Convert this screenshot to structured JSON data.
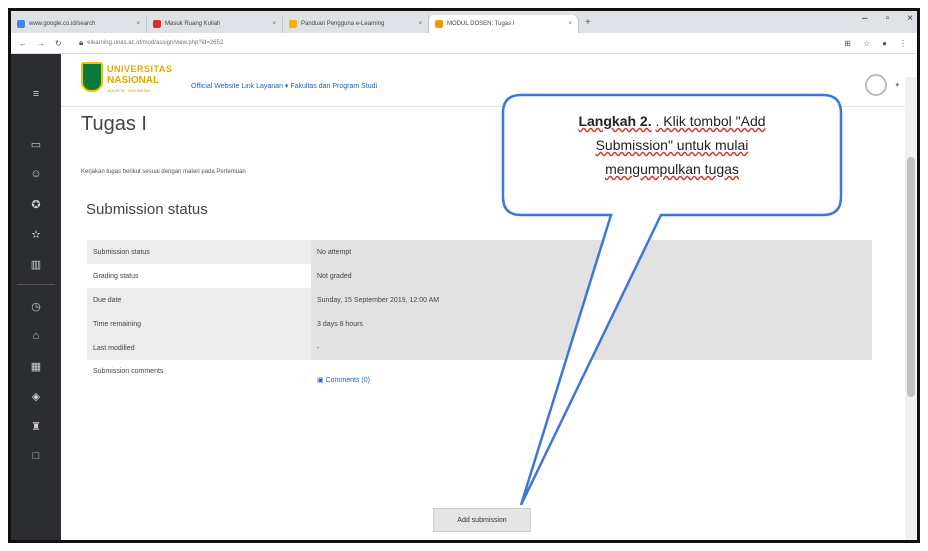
{
  "browser": {
    "tabs": [
      {
        "label": "www.google.co.id/search",
        "color": "#4285f4"
      },
      {
        "label": "Masuk Ruang Kuliah",
        "color": "#d93025"
      },
      {
        "label": "Panduan Pengguna e-Learning",
        "color": "#f4b400"
      },
      {
        "label": "MODUL DOSEN: Tugas I",
        "color": "#f29900"
      }
    ],
    "url": "elearning.unas.ac.id/mod/assign/view.php?id=2652"
  },
  "site": {
    "logo_line1": "UNIVERSITAS",
    "logo_line2": "NASIONAL",
    "logo_line3": "JAKARTA · INDONESIA",
    "menu_text": "Official Website   Link Layanan ▾   Fakultas dan Program Studi"
  },
  "page": {
    "title": "Tugas I",
    "description": "Kerjakan tugas berikut sesuai dengan materi pada Pertemuan",
    "section_title": "Submission status"
  },
  "status_table": [
    {
      "label": "Submission status",
      "value": "No attempt"
    },
    {
      "label": "Grading status",
      "value": "Not graded"
    },
    {
      "label": "Due date",
      "value": "Sunday, 15 September 2019, 12:00 AM"
    },
    {
      "label": "Time remaining",
      "value": "3 days 8 hours"
    },
    {
      "label": "Last modified",
      "value": "-"
    },
    {
      "label": "Submission comments",
      "value": "Comments (0)"
    }
  ],
  "add_submission_label": "Add submission",
  "callout": {
    "bold": "Langkah 2.",
    "line1": ". Klik tombol \"Add",
    "line2": "Submission\" untuk mulai",
    "line3": "mengumpulkan tugas"
  },
  "colors": {
    "sidebar": "#2b2d31",
    "link": "#1a63c7",
    "callout_border": "#3c78d8"
  }
}
